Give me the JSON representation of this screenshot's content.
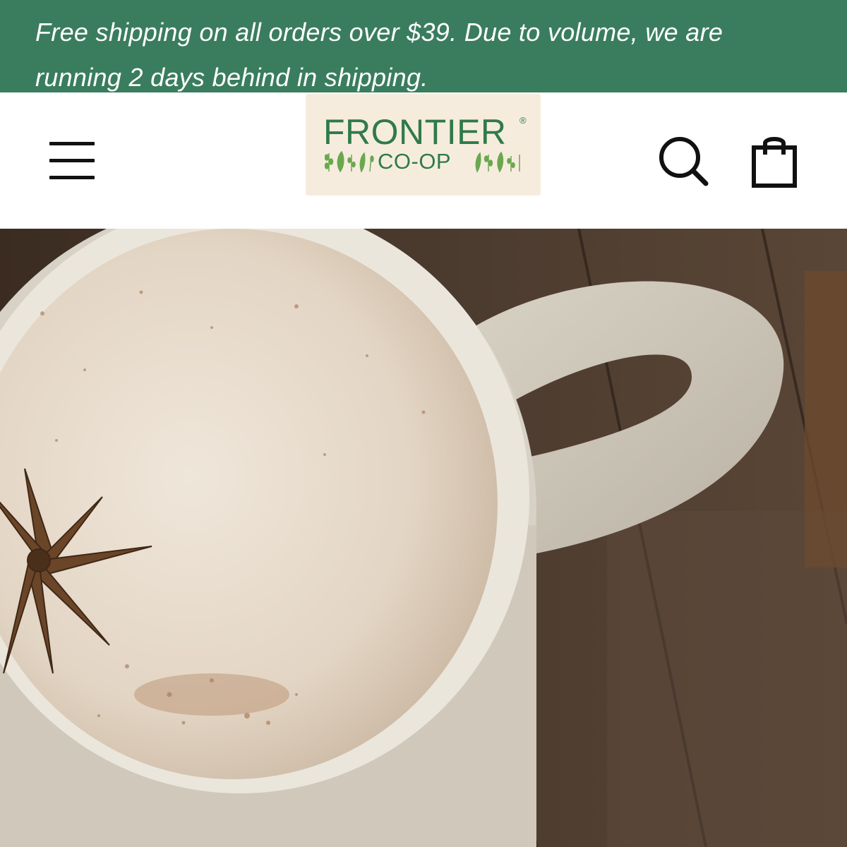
{
  "announcement": {
    "line1": "Free shipping on all orders over $39. Due to volume, we are",
    "line2": "running 2 days behind in shipping."
  },
  "header": {
    "logo": {
      "word": "FRONTIER",
      "registered": "®",
      "sub": "CO-OP"
    },
    "icons": {
      "menu": "hamburger-menu-icon",
      "search": "search-icon",
      "cart": "shopping-bag-icon"
    }
  },
  "hero": {
    "subject": "mug-of-frothy-chai-latte-with-star-anise"
  },
  "colors": {
    "announcement_bg": "#3a7d5e",
    "brand_green": "#2f7a4a",
    "logo_bg": "#f6ecde"
  }
}
